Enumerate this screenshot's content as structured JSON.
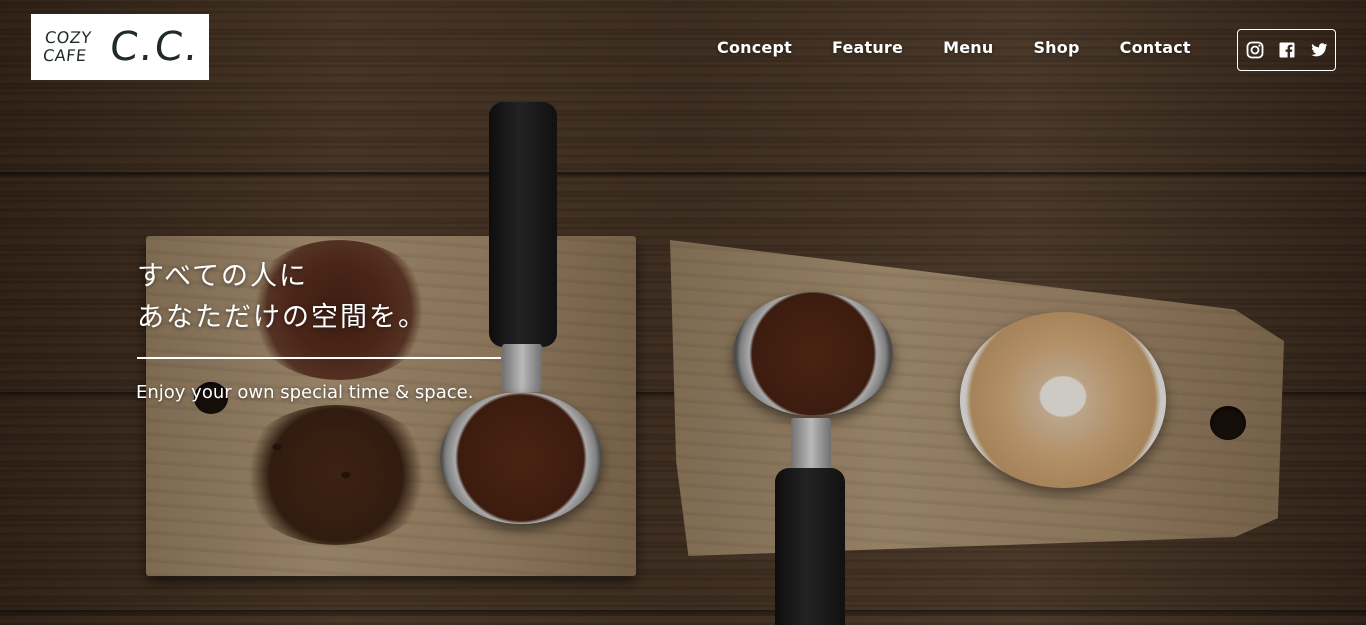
{
  "brand": {
    "logo_small_line1": "COZY",
    "logo_small_line2": "CAFE",
    "logo_big": "C.C.",
    "logo_text_color": "#1f2a2a"
  },
  "nav": {
    "items": [
      {
        "label": "Concept"
      },
      {
        "label": "Feature"
      },
      {
        "label": "Menu"
      },
      {
        "label": "Shop"
      },
      {
        "label": "Contact"
      }
    ]
  },
  "social": {
    "icons": [
      "instagram-icon",
      "facebook-icon",
      "twitter-icon"
    ]
  },
  "hero": {
    "headline_line1": "すべての人に",
    "headline_line2": "あなただけの空間を。",
    "subheadline": "Enjoy your own special time & space.",
    "background_description_icon": "coffee-wood-background"
  }
}
